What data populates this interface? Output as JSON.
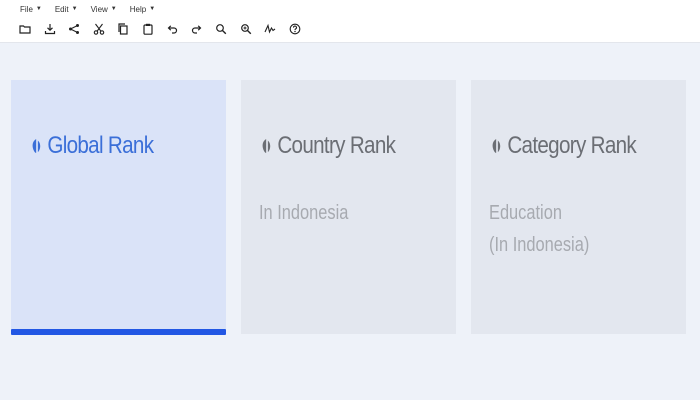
{
  "menu": [
    {
      "label": "File"
    },
    {
      "label": "Edit"
    },
    {
      "label": "View"
    },
    {
      "label": "Help"
    }
  ],
  "toolbar_icons": [
    "folder-icon",
    "download-icon",
    "share-icon",
    "cut-icon",
    "copy-icon",
    "paste-icon",
    "undo-icon",
    "redo-icon",
    "zoom-in-icon",
    "zoom-out-icon",
    "signature-icon",
    "help-icon"
  ],
  "cards": [
    {
      "title": "Global Rank",
      "sub": [],
      "active": true
    },
    {
      "title": "Country Rank",
      "sub": [
        "In Indonesia"
      ],
      "active": false
    },
    {
      "title": "Category Rank",
      "sub": [
        "Education",
        "(In Indonesia)"
      ],
      "active": false
    }
  ],
  "colors": {
    "accent": "#2257e4",
    "active_title": "#3b6fd8",
    "inactive_title": "#6b6e74",
    "subtitle": "#a7aab0"
  }
}
